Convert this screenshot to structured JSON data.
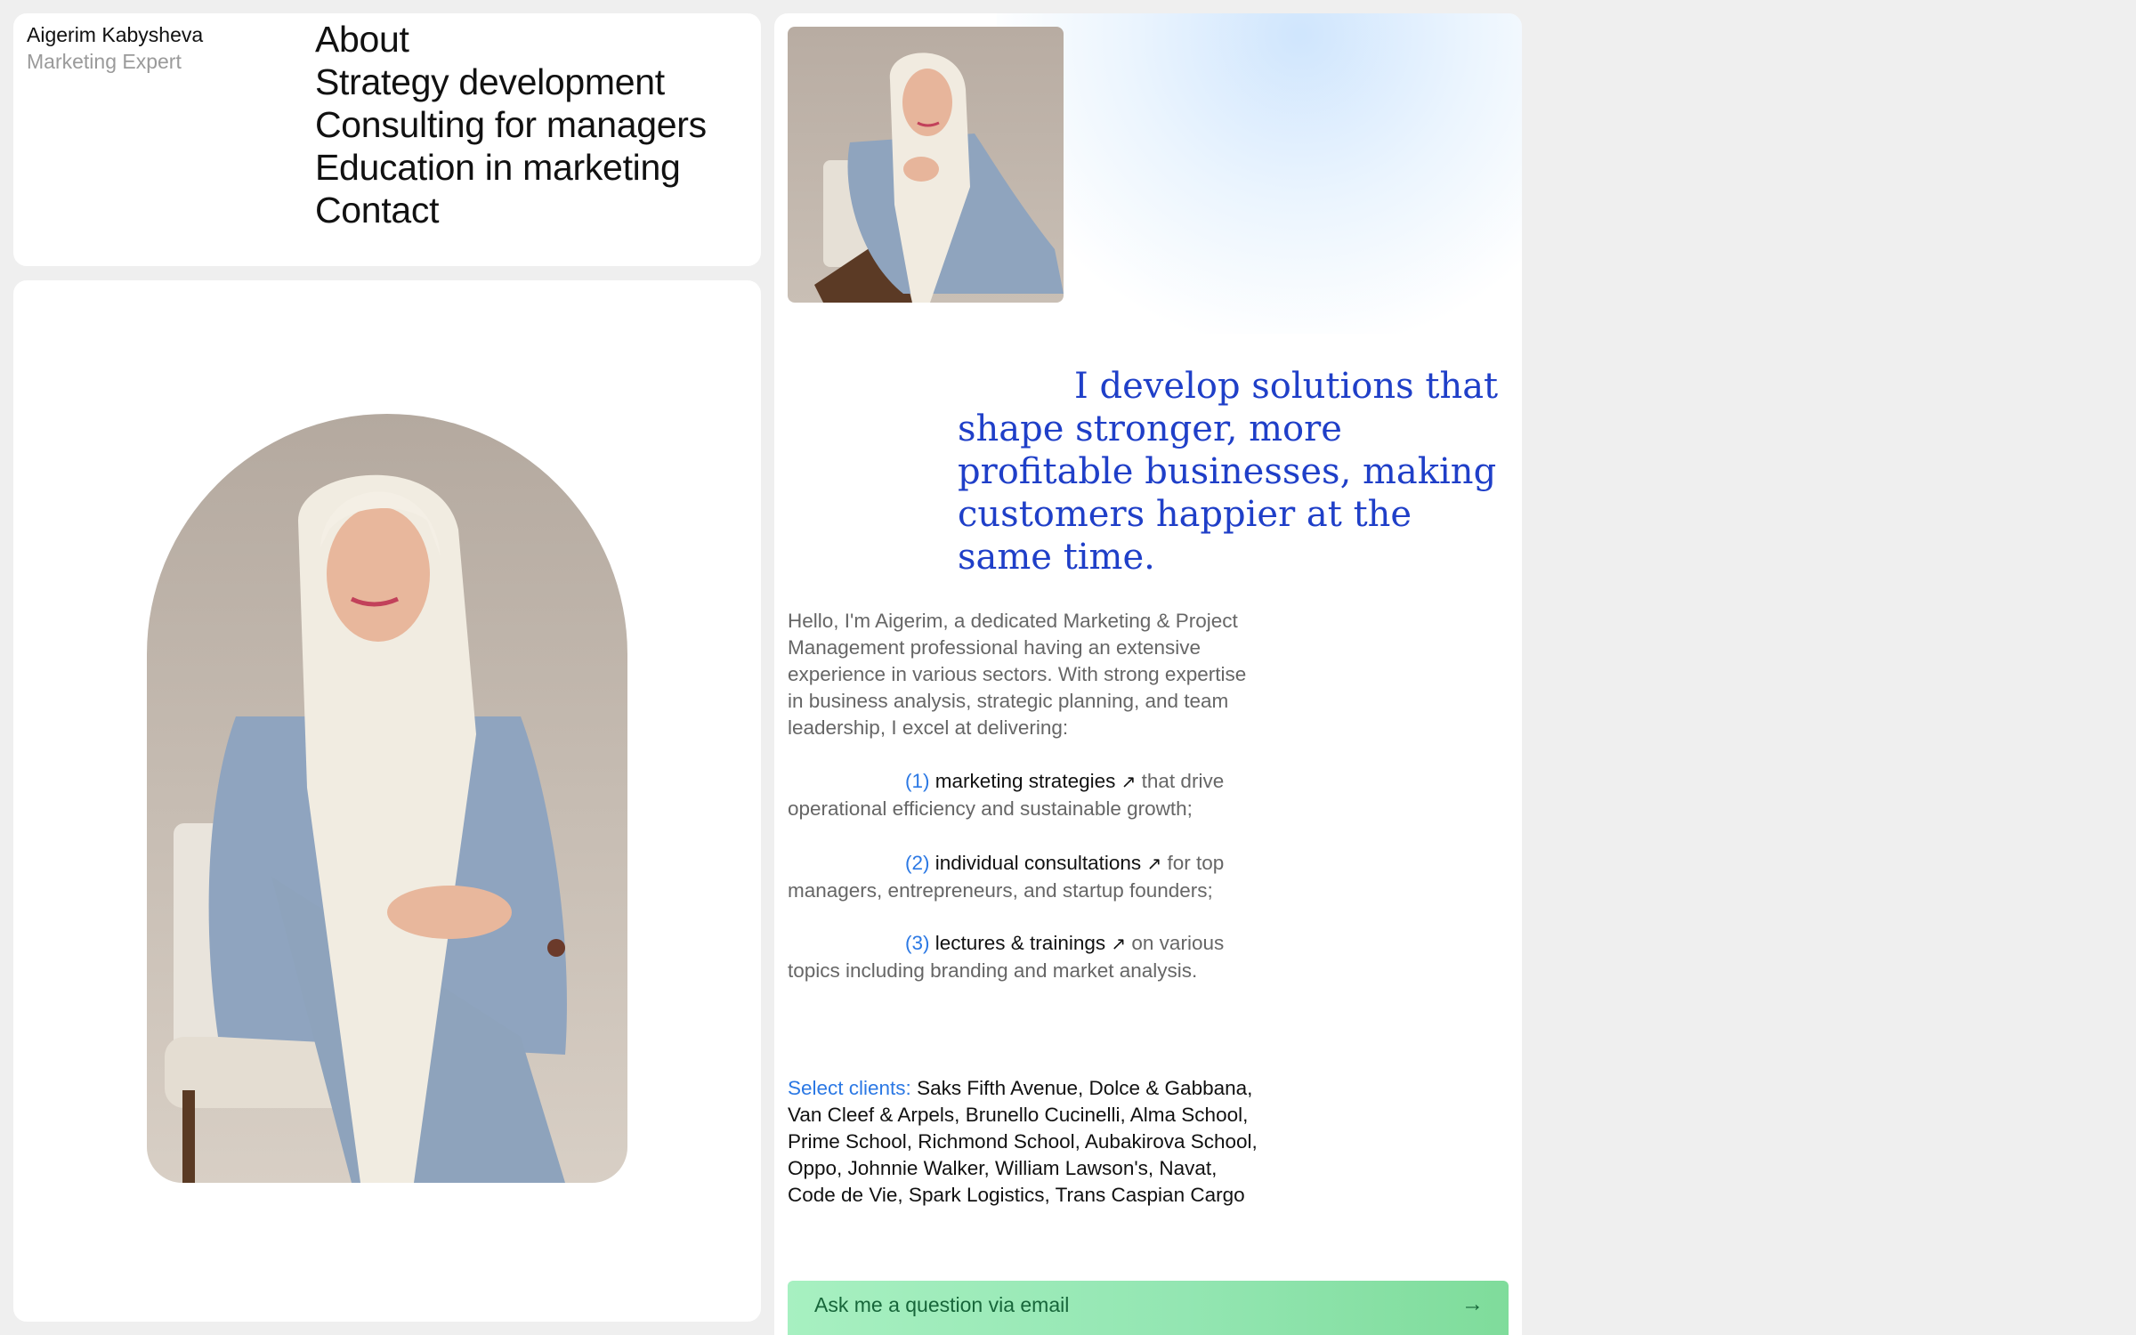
{
  "header": {
    "name": "Aigerim Kabysheva",
    "role": "Marketing Expert"
  },
  "nav": {
    "items": [
      {
        "label": "About"
      },
      {
        "label": "Strategy development"
      },
      {
        "label": "Consulting for managers"
      },
      {
        "label": "Education in marketing"
      },
      {
        "label": "Contact"
      }
    ]
  },
  "hero": {
    "headline": "I develop solutions that shape stronger, more profitable businesses, making customers happier at the same time."
  },
  "intro": {
    "text": "Hello, I'm Aigerim, a dedicated Marketing & Project Management professional having an extensive experience in various sectors. With strong expertise in business analysis, strategic planning, and team leadership, I excel at delivering:"
  },
  "services": [
    {
      "number": "(1)",
      "link": "marketing strategies",
      "rest": "that drive operational efficiency and sustainable growth;"
    },
    {
      "number": "(2)",
      "link": "individual consultations",
      "rest": "for top managers, entrepreneurs, and startup founders;"
    },
    {
      "number": "(3)",
      "link": "lectures & trainings",
      "rest": "on various topics including branding and market analysis."
    }
  ],
  "clients": {
    "label": "Select clients:",
    "list": "Saks Fifth Avenue, Dolce & Gabbana, Van Cleef & Arpels, Brunello Cucinelli, Alma School, Prime School, Richmond School, Aubakirova School, Oppo, Johnnie Walker, William Lawson's, Navat, Code de Vie, Spark Logistics, Trans Caspian Cargo"
  },
  "cta": {
    "label": "Ask me a question via email",
    "arrow": "→"
  },
  "glyphs": {
    "external_arrow": "↗"
  },
  "colors": {
    "accent_blue": "#2b78e4",
    "headline_blue": "#1f3fc8",
    "cta_green": "#93e6b2",
    "page_bg": "#efefef"
  }
}
